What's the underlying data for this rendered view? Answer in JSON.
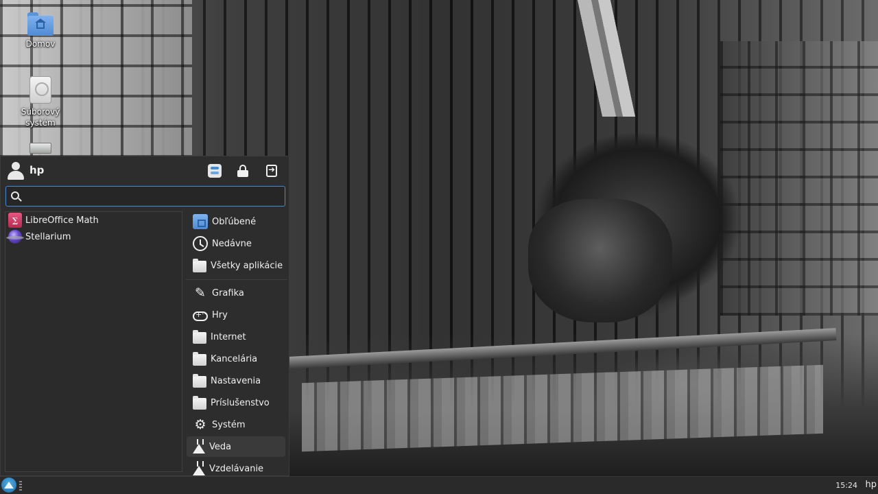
{
  "desktop": {
    "icons": [
      {
        "label": "Domov",
        "icon": "home-folder-icon"
      },
      {
        "label": "Súborový systém",
        "icon": "drive-icon"
      },
      {
        "label": "",
        "icon": "removable-drive-icon"
      }
    ]
  },
  "menu": {
    "user": "hp",
    "header_icons": [
      "settings-icon",
      "lock-icon",
      "logout-icon"
    ],
    "search": {
      "value": "",
      "placeholder": ""
    },
    "apps": [
      {
        "label": "LibreOffice Math",
        "icon": "libreoffice-math-icon"
      },
      {
        "label": "Stellarium",
        "icon": "stellarium-icon"
      }
    ],
    "categories": [
      {
        "label": "Obľúbené",
        "icon": "favorites-folder-icon"
      },
      {
        "label": "Nedávne",
        "icon": "clock-icon"
      },
      {
        "label": "Všetky aplikácie",
        "icon": "all-apps-icon"
      },
      {
        "label": "Grafika",
        "icon": "graphics-icon"
      },
      {
        "label": "Hry",
        "icon": "gamepad-icon"
      },
      {
        "label": "Internet",
        "icon": "internet-icon"
      },
      {
        "label": "Kancelária",
        "icon": "office-icon"
      },
      {
        "label": "Nastavenia",
        "icon": "settings-category-icon"
      },
      {
        "label": "Príslušenstvo",
        "icon": "accessories-icon"
      },
      {
        "label": "Systém",
        "icon": "system-gear-icon"
      },
      {
        "label": "Veda",
        "icon": "flask-icon"
      },
      {
        "label": "Vzdelávanie",
        "icon": "education-icon"
      }
    ],
    "selected_category": "Veda"
  },
  "taskbar": {
    "clock": "15:24",
    "user": "hp"
  },
  "colors": {
    "accent": "#4a88d8",
    "menu_bg": "#2d2d2d",
    "taskbar_bg": "#2a2a2a"
  }
}
